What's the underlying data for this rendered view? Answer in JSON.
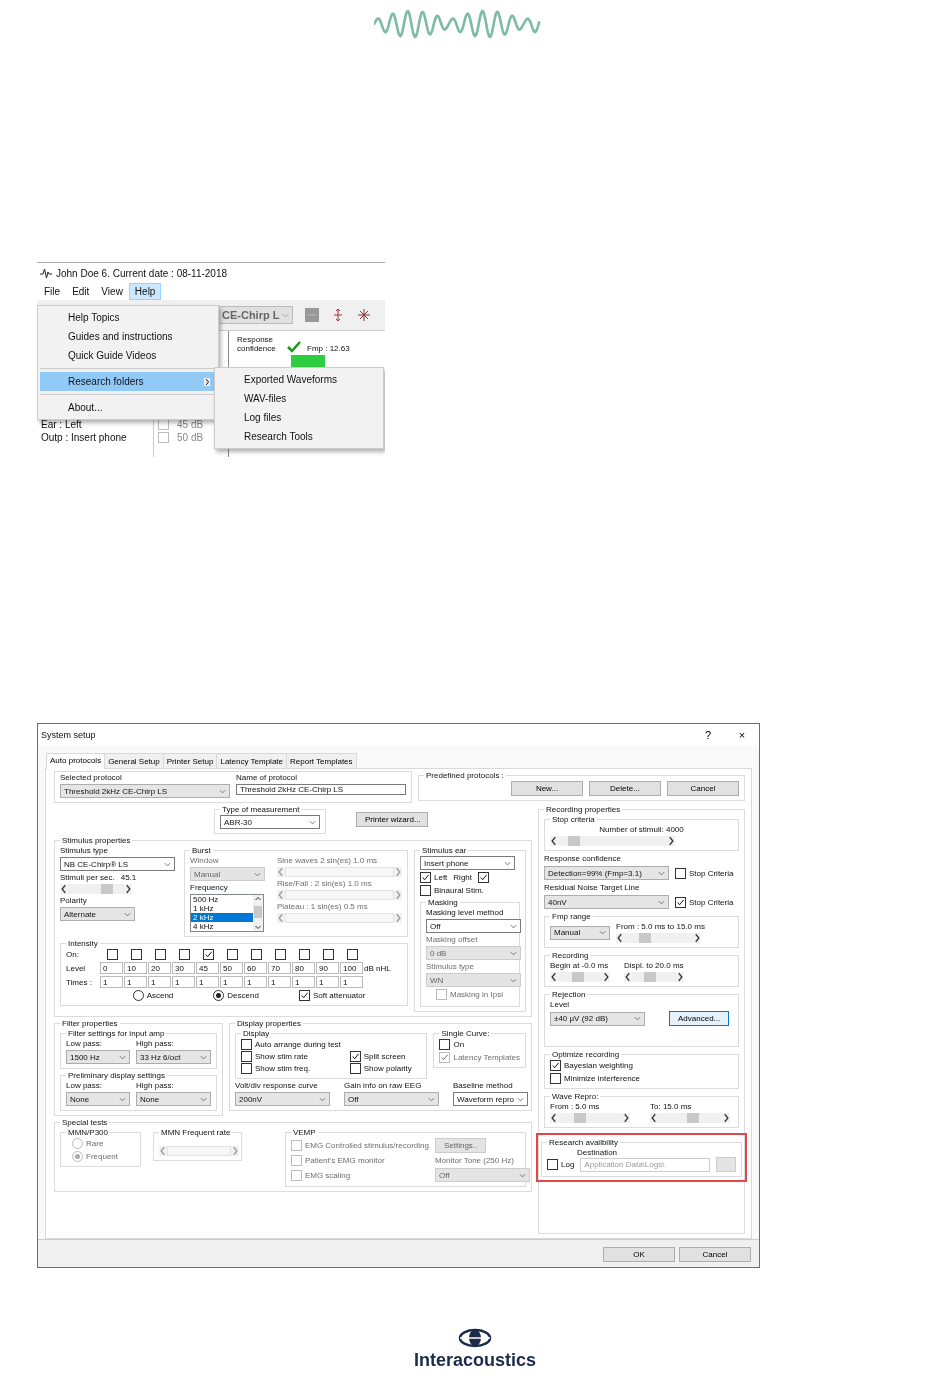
{
  "menu_screenshot": {
    "title": "John Doe 6. Current date : 08-11-2018",
    "menubar": [
      {
        "label": "File",
        "selected": false
      },
      {
        "label": "Edit",
        "selected": false
      },
      {
        "label": "View",
        "selected": false
      },
      {
        "label": "Help",
        "selected": true
      }
    ],
    "menu": [
      {
        "kind": "item",
        "label": "Help Topics",
        "selected": false,
        "submenu": false
      },
      {
        "kind": "item",
        "label": "Guides and instructions",
        "selected": false,
        "submenu": false
      },
      {
        "kind": "item",
        "label": "Quick Guide Videos",
        "selected": false,
        "submenu": false
      },
      {
        "kind": "separator"
      },
      {
        "kind": "item",
        "label": "Research folders",
        "selected": true,
        "submenu": true
      },
      {
        "kind": "separator"
      },
      {
        "kind": "item",
        "label": "About...",
        "selected": false,
        "submenu": false
      }
    ],
    "submenu": [
      "Exported Waveforms",
      "WAV-files",
      "Log files",
      "Research Tools"
    ],
    "background": {
      "protocol_dropdown": "CE-Chirp L",
      "response_label": "Response confidence",
      "fmp": "Fmp : 12.63",
      "info": [
        "Ear :  Left",
        "Outp : Insert phone"
      ],
      "levels": [
        {
          "label": "45 dB",
          "checked": false
        },
        {
          "label": "50 dB",
          "checked": false
        }
      ]
    }
  },
  "dialog": {
    "title": "System setup",
    "help": "?",
    "close": "×",
    "tabs": [
      {
        "label": "Auto protocols",
        "selected": true
      },
      {
        "label": "General Setup",
        "selected": false
      },
      {
        "label": "Printer Setup",
        "selected": false
      },
      {
        "label": "Latency Template",
        "selected": false
      },
      {
        "label": "Report Templates",
        "selected": false
      }
    ],
    "protocol": {
      "selected_label": "Selected protocol",
      "selected_value": "Threshold 2kHz CE-Chirp LS",
      "name_label": "Name of protocol",
      "name_value": "Threshold 2kHz CE-Chirp LS",
      "predefined_label": "Predefined protocols :",
      "buttons": [
        "New...",
        "Delete...",
        "Cancel"
      ]
    },
    "measurement": {
      "label": "Type of measurement",
      "value": "ABR-30",
      "wizard_button": "Printer wizard..."
    },
    "stimulus": {
      "title": "Stimulus properties",
      "type_label": "Stimulus type",
      "type_value": "NB CE-Chirp® LS",
      "rate_label": "Stimuli per sec.",
      "rate_value": "45.1",
      "rate_slider": {
        "level": 0.7
      },
      "polarity_label": "Polarity",
      "polarity_value": "Alternate",
      "burst": {
        "title": "Burst",
        "window": {
          "label": "Window",
          "value": "Manual",
          "disabled": true
        },
        "frequency_label": "Frequency",
        "frequencies": [
          {
            "label": "500 Hz",
            "selected": false
          },
          {
            "label": "1 kHz",
            "selected": false
          },
          {
            "label": "2 kHz",
            "selected": true
          },
          {
            "label": "4 kHz",
            "selected": false
          }
        ],
        "timing": [
          {
            "label": "Sine waves 2 sin(es) 1.0 ms",
            "disabled": true
          },
          {
            "label": "Rise/Fall : 2 sin(es) 1.0 ms",
            "disabled": true
          },
          {
            "label": "Plateau :  1 sin(es) 0.5 ms",
            "disabled": true
          }
        ]
      },
      "ear": {
        "title": "Stimulus ear",
        "value": "Insert phone",
        "left": {
          "label": "Left",
          "checked": true
        },
        "right": {
          "label": "Right",
          "checked": true
        },
        "binaural": {
          "label": "Binaural Stim.",
          "checked": false
        },
        "masking": {
          "title": "Masking",
          "method_label": "Masking level method",
          "method_value": "Off",
          "offset": {
            "label": "Masking offset",
            "value": "0 dB",
            "disabled": true
          },
          "stim_type": {
            "label": "Stimulus type",
            "value": "WN",
            "disabled": true
          },
          "ipsi": {
            "label": "Masking in Ipsi",
            "checked": false,
            "disabled": true
          }
        }
      },
      "intensity": {
        "title": "Intensity",
        "on_label": "On:",
        "level_label": "Level",
        "times_label": "Times :",
        "unit": "dB nHL",
        "steps": [
          {
            "on": false,
            "level": "0",
            "times": "1"
          },
          {
            "on": false,
            "level": "10",
            "times": "1"
          },
          {
            "on": false,
            "level": "20",
            "times": "1"
          },
          {
            "on": false,
            "level": "30",
            "times": "1"
          },
          {
            "on": true,
            "level": "45",
            "times": "1"
          },
          {
            "on": false,
            "level": "50",
            "times": "1"
          },
          {
            "on": false,
            "level": "60",
            "times": "1"
          },
          {
            "on": false,
            "level": "70",
            "times": "1"
          },
          {
            "on": false,
            "level": "80",
            "times": "1"
          },
          {
            "on": false,
            "level": "90",
            "times": "1"
          },
          {
            "on": false,
            "level": "100",
            "times": "1"
          }
        ],
        "ascend": {
          "label": "Ascend",
          "selected": false
        },
        "descend": {
          "label": "Descend",
          "selected": true
        },
        "soft": {
          "label": "Soft attenuator",
          "checked": true
        }
      }
    },
    "recording": {
      "title": "Recording properties",
      "stop": {
        "title": "Stop criteria",
        "stimuli": "Number of stimuli:  4000",
        "slider": {
          "level": 0.15
        }
      },
      "confidence": {
        "label": "Response confidence",
        "value": "Detection=99% (Fmp=3.1)",
        "stop": {
          "label": "Stop Criteria",
          "checked": false
        }
      },
      "noise": {
        "label": "Residual Noise Target Line",
        "value": "40nV",
        "stop": {
          "label": "Stop Criteria",
          "checked": true
        }
      },
      "fmp": {
        "title": "Fmp range",
        "value": "Manual",
        "range": "From : 5.0 ms to 15.0 ms",
        "slider": {
          "level": 0.3
        }
      },
      "window": {
        "title": "Recording",
        "begin": "Begin at  -0.0 ms",
        "begin_slider": {
          "level": 0.45
        },
        "displ": "Displ. to  20.0 ms",
        "displ_slider": {
          "level": 0.4
        }
      },
      "rejection": {
        "title": "Rejection",
        "level_label": "Level",
        "level_value": "±40 µV (92 dB)",
        "advanced": "Advanced..."
      },
      "optimize": {
        "title": "Optimize recording",
        "options": [
          {
            "label": "Bayesian weighting",
            "checked": true
          },
          {
            "label": "Minimize interference",
            "checked": false
          }
        ]
      },
      "repro": {
        "title": "Wave Repro:",
        "from": "From : 5.0 ms",
        "from_slider": {
          "level": 0.35
        },
        "to": "To:   15.0 ms",
        "to_slider": {
          "level": 0.55
        }
      },
      "research": {
        "title": "Research availbility",
        "highlighted": true,
        "destination_label": "Destination",
        "log": {
          "label": "Log",
          "checked": false
        },
        "path": "Application Data\\Logs\\"
      }
    },
    "filter": {
      "title": "Filter properties",
      "input": {
        "title": "Filter settings for input amp",
        "low_label": "Low pass:",
        "low_value": "1500 Hz",
        "high_label": "High pass:",
        "high_value": "33 Hz 6/oct"
      },
      "display": {
        "title": "Preliminary display settings",
        "low_label": "Low pass:",
        "low_value": "None",
        "high_label": "High pass:",
        "high_value": "None"
      }
    },
    "display": {
      "title": "Display properties",
      "group_title": "Display",
      "options": [
        {
          "label": "Auto arrange during test",
          "checked": false
        },
        {
          "label": "Show stim rate",
          "checked": false
        },
        {
          "label": "Split screen",
          "checked": true
        },
        {
          "label": "Show stim freq.",
          "checked": false
        },
        {
          "label": "Show polarity",
          "checked": false
        }
      ],
      "single": {
        "title": "Single Curve:",
        "on": {
          "label": "On",
          "checked": false
        },
        "latency": {
          "label": "Latency Templates",
          "checked": true,
          "disabled": true
        }
      },
      "volt_label": "Volt/div response curve",
      "volt_value": "200nV",
      "gain_label": "Gain info on raw EEG",
      "gain_value": "Off",
      "baseline_label": "Baseline method",
      "baseline_value": "Waveform repro"
    },
    "special": {
      "title": "Special tests",
      "mmn": {
        "title": "MMN/P300",
        "disabled": true,
        "options": [
          {
            "label": "Rare",
            "selected": false
          },
          {
            "label": "Frequent",
            "selected": true
          }
        ]
      },
      "rate": {
        "title": "MMN Frequent rate",
        "disabled": true
      },
      "vemp": {
        "title": "VEMP",
        "disabled": true,
        "options": [
          {
            "label": "EMG Controlled stimulus/recording",
            "checked": false
          },
          {
            "label": "Patient's EMG monitor",
            "checked": false
          },
          {
            "label": "EMG scaling",
            "checked": false
          }
        ],
        "settings": "Settings..",
        "tone_label": "Monitor Tone (250 Hz)",
        "tone_value": "Off"
      }
    },
    "footer": [
      "OK",
      "Cancel"
    ]
  },
  "brand": "Interacoustics"
}
